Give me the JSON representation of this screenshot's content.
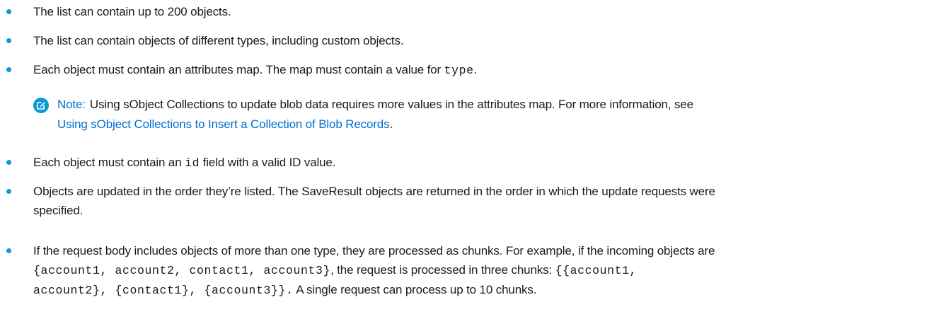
{
  "bullets": {
    "b1": {
      "text": "The list can contain up to 200 objects."
    },
    "b2": {
      "text": "The list can contain objects of different types, including custom objects."
    },
    "b3": {
      "pre": "Each object must contain an attributes map. The map must contain a value for ",
      "code": "type",
      "post": "."
    },
    "b4": {
      "pre": "Each object must contain an ",
      "code": "id",
      "post": " field with a valid ID value."
    },
    "b5": {
      "line1": "Objects are updated in the order they’re listed. The SaveResult objects are returned in the order in which the update requests were",
      "line2": "specified."
    },
    "b6": {
      "line1": "If the request body includes objects of more than one type, they are processed as chunks. For example, if the incoming objects are",
      "code1": "{account1, account2, contact1, account3}",
      "mid1": ", the request is processed in three chunks: ",
      "code2a": "{{account1,",
      "code2b": "account2}, {contact1}, {account3}}.",
      "post": " A single request can process up to 10 chunks."
    }
  },
  "note": {
    "icon": "edit-note-icon",
    "label": "Note:",
    "text": "Using sObject Collections to update blob data requires more values in the attributes map. For more information, see",
    "link": "Using sObject Collections to Insert a Collection of Blob Records",
    "after_link": "."
  },
  "colors": {
    "bullet": "#0c9ad5",
    "link": "#0070d2",
    "text": "#1b1b1b"
  }
}
